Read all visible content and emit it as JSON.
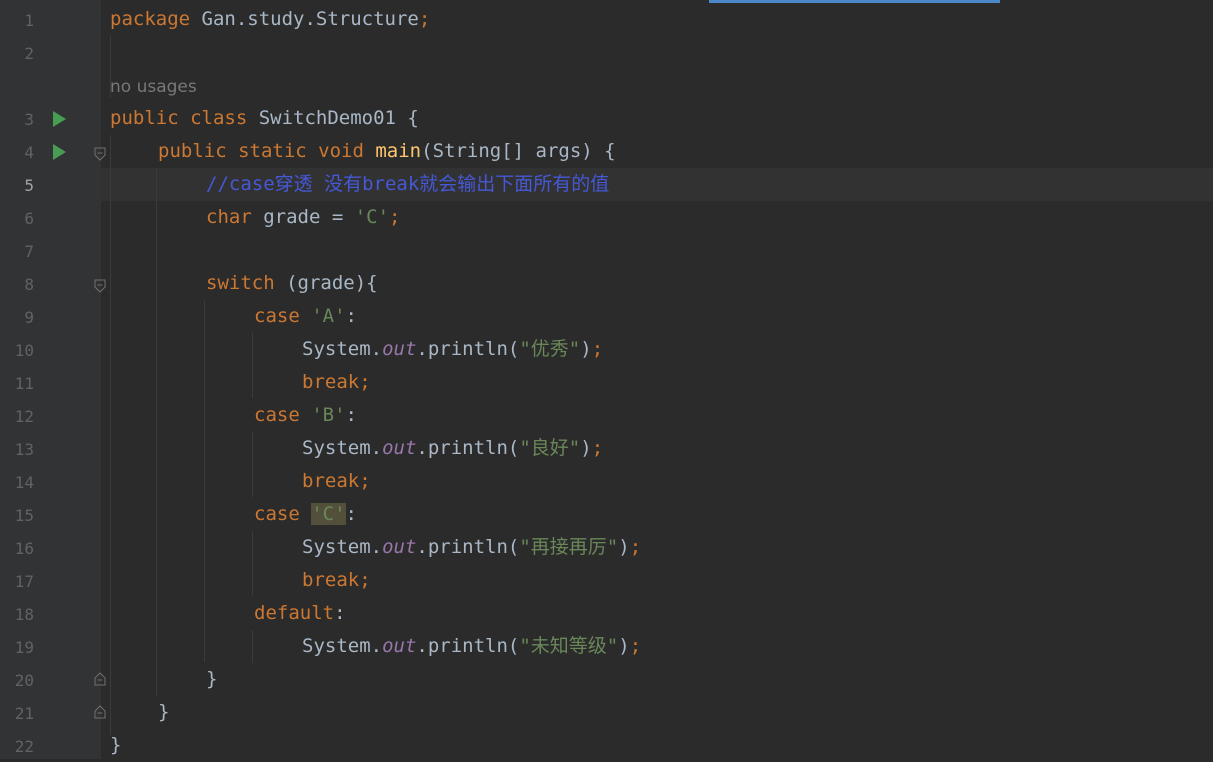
{
  "editor": {
    "usage_hint": "no usages",
    "current_line": 5,
    "line_numbers": [
      "1",
      "2",
      "3",
      "4",
      "5",
      "6",
      "7",
      "8",
      "9",
      "10",
      "11",
      "12",
      "13",
      "14",
      "15",
      "16",
      "17",
      "18",
      "19",
      "20",
      "21",
      "22"
    ],
    "code": {
      "l1_kw": "package",
      "l1_rest": " Gan.study.Structure",
      "l1_semi": ";",
      "l3_kw": "public class",
      "l3_rest": " SwitchDemo01 {",
      "l4_kw": "public static void",
      "l4_fn": "main",
      "l4_rest": "(String[] args) {",
      "l5_comment": "//case穿透 没有break就会输出下面所有的值",
      "l6_kw": "char",
      "l6_mid": " grade = ",
      "l6_str": "'C'",
      "l6_semi": ";",
      "l8_kw": "switch",
      "l8_rest": " (grade){",
      "l9_kw": "case",
      "l9_str": "'A'",
      "l9_colon": ":",
      "l10_a": "System.",
      "l10_out": "out",
      "l10_b": ".println(",
      "l10_str": "\"优秀\"",
      "l10_c": ")",
      "l10_semi": ";",
      "l11_kw": "break;",
      "l12_kw": "case",
      "l12_str": "'B'",
      "l12_colon": ":",
      "l13_a": "System.",
      "l13_out": "out",
      "l13_b": ".println(",
      "l13_str": "\"良好\"",
      "l13_c": ")",
      "l13_semi": ";",
      "l14_kw": "break;",
      "l15_kw": "case",
      "l15_str": "'C'",
      "l15_colon": ":",
      "l16_a": "System.",
      "l16_out": "out",
      "l16_b": ".println(",
      "l16_str": "\"再接再厉\"",
      "l16_c": ")",
      "l16_semi": ";",
      "l17_kw": "break;",
      "l18_kw": "default",
      "l18_colon": ":",
      "l19_a": "System.",
      "l19_out": "out",
      "l19_b": ".println(",
      "l19_str": "\"未知等级\"",
      "l19_c": ")",
      "l19_semi": ";",
      "l20": "}",
      "l21": "}",
      "l22": "}"
    }
  }
}
